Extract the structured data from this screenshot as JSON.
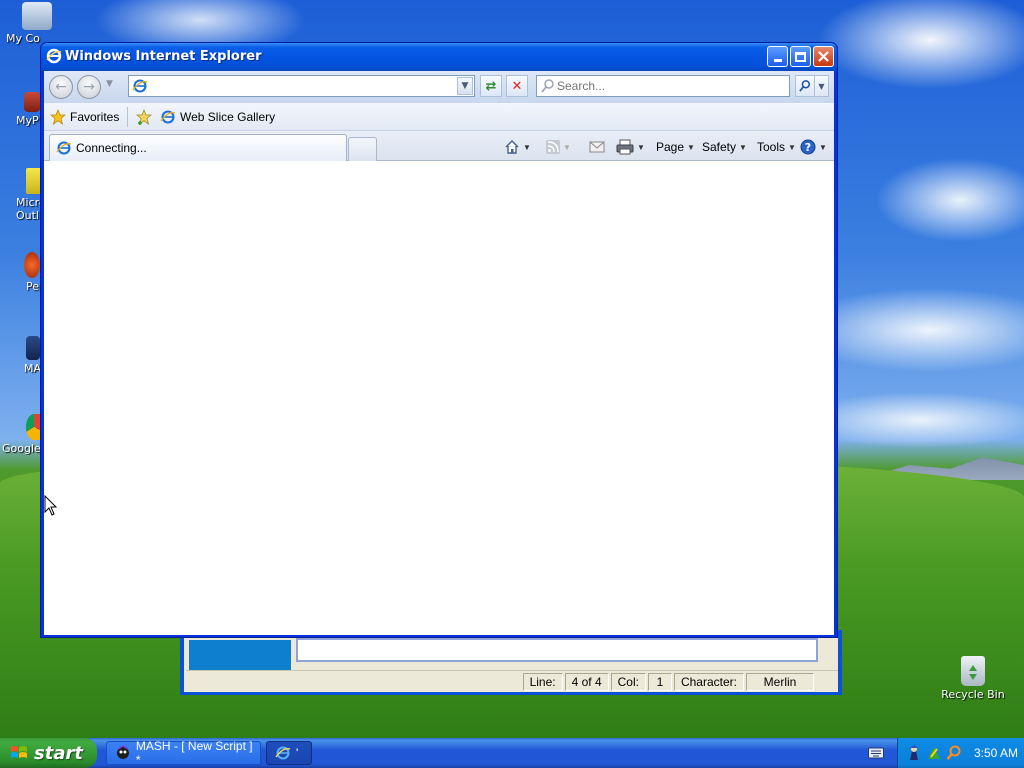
{
  "desktop": {
    "icons": [
      {
        "label": "My Co"
      },
      {
        "label": "MyP"
      },
      {
        "label": "Micro Outl"
      },
      {
        "label": "Pe"
      },
      {
        "label": "MA"
      },
      {
        "label": "Google"
      },
      {
        "label": "Recycle Bin"
      }
    ]
  },
  "mash_window": {
    "status": {
      "line_label": "Line:",
      "line_value": "4 of 4",
      "col_label": "Col:",
      "col_value": "1",
      "char_label": "Character:",
      "char_value": "Merlin"
    }
  },
  "ie": {
    "title": "Windows Internet Explorer",
    "address": {
      "value": ""
    },
    "search": {
      "placeholder": "Search..."
    },
    "favorites": {
      "favorites_label": "Favorites",
      "web_slice_label": "Web Slice Gallery"
    },
    "tab": {
      "label": "Connecting..."
    },
    "commands": {
      "page": "Page",
      "safety": "Safety",
      "tools": "Tools"
    }
  },
  "taskbar": {
    "start_label": "start",
    "tasks": [
      {
        "label": "MASH - [ New Script ] *"
      },
      {
        "label": "'"
      }
    ],
    "clock": "3:50 AM"
  },
  "colors": {
    "titlebar": "#0554e3",
    "taskbar": "#2157d7",
    "start": "#3fab3f",
    "tray": "#0c7fd9"
  }
}
